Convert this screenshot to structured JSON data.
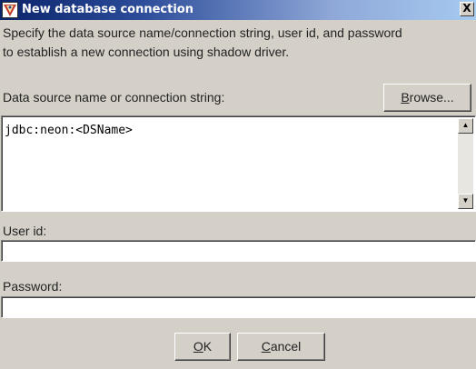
{
  "window": {
    "title": "New database connection",
    "close_label": "X"
  },
  "description": {
    "line1": "Specify the data source name/connection string, user id, and password",
    "line2": "to establish a new connection using shadow driver."
  },
  "dsn": {
    "label": "Data source name or connection string:",
    "value": "jdbc:neon:<DSName>",
    "browse_mnemonic": "B",
    "browse_rest": "rowse..."
  },
  "user": {
    "label": "User id:",
    "value": ""
  },
  "password": {
    "label": "Password:",
    "value": ""
  },
  "buttons": {
    "ok_mnemonic": "O",
    "ok_rest": "K",
    "cancel_mnemonic": "C",
    "cancel_rest": "ancel"
  },
  "icons": {
    "title": "database-connection-icon",
    "scroll_up": "arrow-up-icon",
    "scroll_down": "arrow-down-icon"
  }
}
